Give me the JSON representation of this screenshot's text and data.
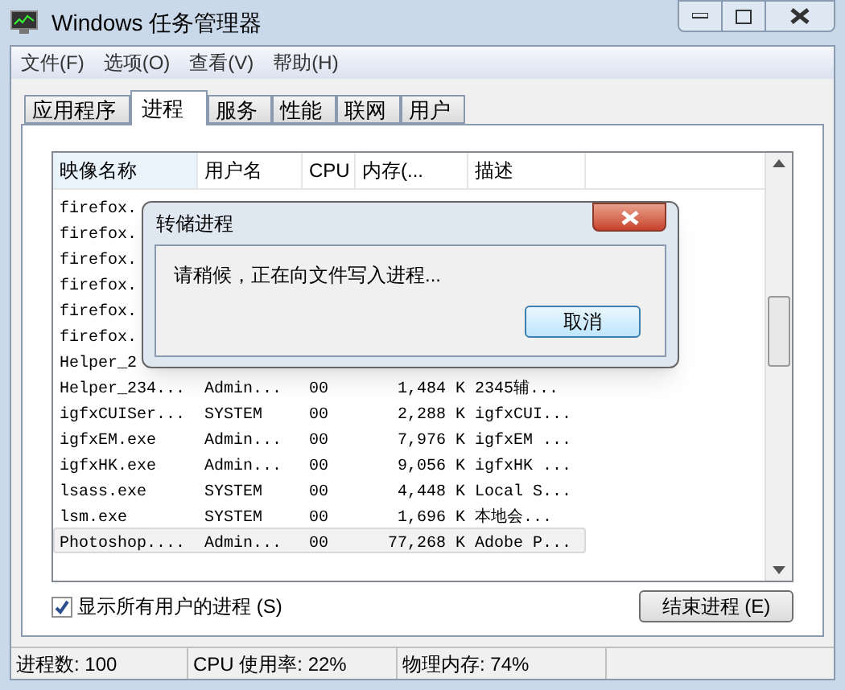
{
  "window": {
    "title": "Windows 任务管理器"
  },
  "menu": [
    "文件(F)",
    "选项(O)",
    "查看(V)",
    "帮助(H)"
  ],
  "tabs": [
    {
      "label": "应用程序",
      "selected": false
    },
    {
      "label": "进程",
      "selected": true
    },
    {
      "label": "服务",
      "selected": false
    },
    {
      "label": "性能",
      "selected": false
    },
    {
      "label": "联网",
      "selected": false
    },
    {
      "label": "用户",
      "selected": false
    }
  ],
  "table": {
    "columns": [
      "映像名称",
      "用户名",
      "CPU",
      "内存(...",
      "描述"
    ],
    "rows": [
      {
        "cells": [
          "firefox."
        ],
        "selected": false
      },
      {
        "cells": [
          "firefox."
        ],
        "selected": false
      },
      {
        "cells": [
          "firefox."
        ],
        "selected": false
      },
      {
        "cells": [
          "firefox."
        ],
        "selected": false
      },
      {
        "cells": [
          "firefox."
        ],
        "selected": false
      },
      {
        "cells": [
          "firefox."
        ],
        "selected": false
      },
      {
        "cells": [
          "Helper_2"
        ],
        "selected": false
      },
      {
        "cells": [
          "Helper_234...",
          "Admin...",
          "00",
          "1,484 K",
          "2345辅..."
        ],
        "selected": false
      },
      {
        "cells": [
          "igfxCUISer...",
          "SYSTEM",
          "00",
          "2,288 K",
          "igfxCUI..."
        ],
        "selected": false
      },
      {
        "cells": [
          "igfxEM.exe",
          "Admin...",
          "00",
          "7,976 K",
          "igfxEM ..."
        ],
        "selected": false
      },
      {
        "cells": [
          "igfxHK.exe",
          "Admin...",
          "00",
          "9,056 K",
          "igfxHK ..."
        ],
        "selected": false
      },
      {
        "cells": [
          "lsass.exe",
          "SYSTEM",
          "00",
          "4,448 K",
          "Local S..."
        ],
        "selected": false
      },
      {
        "cells": [
          "lsm.exe",
          "SYSTEM",
          "00",
          "1,696 K",
          "本地会..."
        ],
        "selected": false
      },
      {
        "cells": [
          "Photoshop....",
          "Admin...",
          "00",
          "77,268 K",
          "Adobe P..."
        ],
        "selected": true
      }
    ]
  },
  "show_all_users": {
    "label": "显示所有用户的进程 (S)",
    "checked": true
  },
  "end_process_button": "结束进程 (E)",
  "dialog": {
    "title": "转储进程",
    "message": "请稍候，正在向文件写入进程...",
    "cancel_button": "取消"
  },
  "status_bar": [
    "进程数: 100",
    "CPU 使用率: 22%",
    "物理内存: 74%"
  ]
}
